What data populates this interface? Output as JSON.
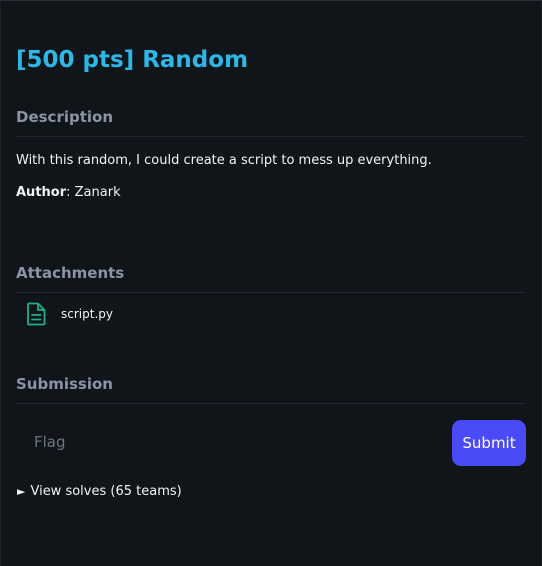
{
  "challenge": {
    "title": "[500 pts] Random"
  },
  "description": {
    "heading": "Description",
    "text": "With this random, I could create a script to mess up everything.",
    "author_label": "Author",
    "author_name": ": Zanark"
  },
  "attachments": {
    "heading": "Attachments",
    "files": [
      {
        "name": "script.py",
        "icon": "file-text-icon"
      }
    ]
  },
  "submission": {
    "heading": "Submission",
    "flag_placeholder": "Flag",
    "flag_value": "",
    "submit_label": "Submit",
    "view_solves_label": "View solves (65 teams)",
    "expand_icon": "►"
  },
  "colors": {
    "accent_title": "#2fb6e8",
    "submit_button": "#4b4af7",
    "attachment_icon": "#1fae8f",
    "background": "#101519"
  }
}
